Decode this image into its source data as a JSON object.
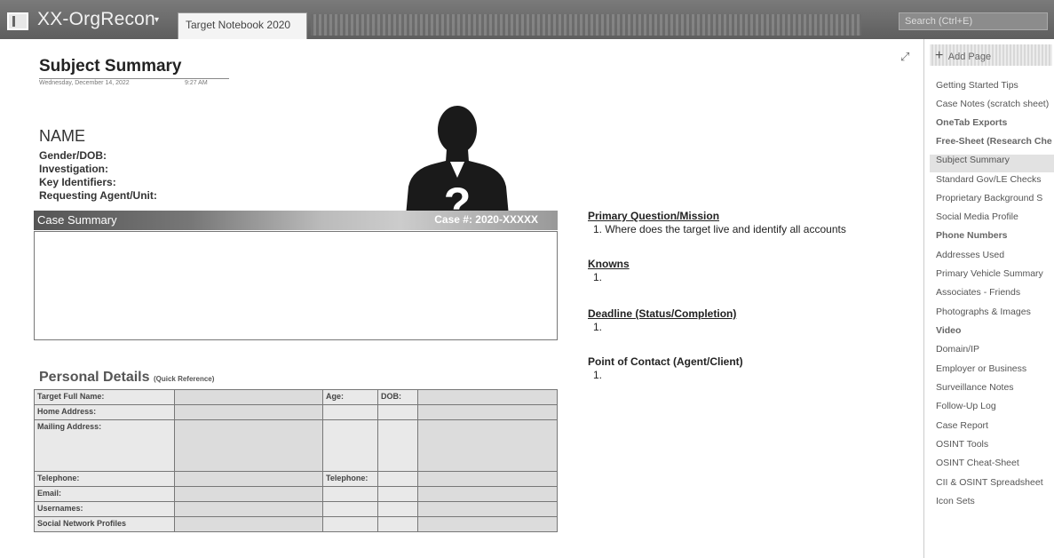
{
  "titlebar": {
    "notebook_name": "XX-OrgRecon",
    "dropdown_glyph": "▾",
    "active_tab": "Target Notebook 2020",
    "search_placeholder": "Search (Ctrl+E)"
  },
  "page": {
    "title": "Subject Summary",
    "date": "Wednesday, December 14, 2022",
    "time": "9:27 AM",
    "expand_glyph": "⤢",
    "name_heading": "NAME",
    "fields": [
      "Gender/DOB:",
      "Investigation:",
      "Key Identifiers:",
      "Requesting Agent/Unit:"
    ],
    "photo_placeholder_icon": "person-question-icon",
    "case_summary_label": "Case Summary",
    "case_number": "Case #: 2020-XXXXX"
  },
  "personal_details": {
    "heading": "Personal Details",
    "subheading": "(Quick Reference)",
    "rows": [
      [
        "Target Full Name:",
        "",
        "Age:",
        "DOB:",
        ""
      ],
      [
        "Home Address:",
        "",
        "",
        "",
        ""
      ],
      [
        "Mailing Address:",
        "",
        "",
        "",
        ""
      ],
      [
        "Telephone:",
        "",
        "Telephone:",
        "",
        ""
      ],
      [
        "Email:",
        "",
        "",
        "",
        ""
      ],
      [
        "Usernames:",
        "",
        "",
        "",
        ""
      ],
      [
        "Social Network Profiles",
        "",
        "",
        "",
        ""
      ]
    ]
  },
  "right_column": [
    {
      "heading": "Primary Question/Mission",
      "item": "1.   Where does the target live and identify all accounts"
    },
    {
      "heading": "Knowns",
      "item": "1."
    },
    {
      "heading": "Deadline (Status/Completion)",
      "item": "1."
    },
    {
      "heading": "Point of Contact (Agent/Client)",
      "item": "1."
    }
  ],
  "sidebar": {
    "add_page_label": "Add Page",
    "selected_index": 5,
    "pages": [
      {
        "label": "Getting Started Tips",
        "bold": false
      },
      {
        "label": "Case Notes (scratch sheet)",
        "bold": false
      },
      {
        "label": "OneTab Exports",
        "bold": true
      },
      {
        "label": "Free-Sheet (Research Che",
        "bold": true
      },
      {
        "label": "Subject Summary",
        "bold": false
      },
      {
        "label": "Standard Gov/LE Checks",
        "bold": false
      },
      {
        "label": "Proprietary Background S",
        "bold": false
      },
      {
        "label": "Social Media Profile",
        "bold": false
      },
      {
        "label": "Phone Numbers",
        "bold": true
      },
      {
        "label": "Addresses Used",
        "bold": false
      },
      {
        "label": "Primary Vehicle Summary",
        "bold": false
      },
      {
        "label": "Associates - Friends",
        "bold": false
      },
      {
        "label": "Photographs & Images",
        "bold": false
      },
      {
        "label": "Video",
        "bold": true
      },
      {
        "label": "Domain/IP",
        "bold": false
      },
      {
        "label": "Employer or Business",
        "bold": false
      },
      {
        "label": "Surveillance Notes",
        "bold": false
      },
      {
        "label": "Follow-Up Log",
        "bold": false
      },
      {
        "label": "Case Report",
        "bold": false
      },
      {
        "label": "OSINT Tools",
        "bold": false
      },
      {
        "label": "OSINT Cheat-Sheet",
        "bold": false
      },
      {
        "label": "CII & OSINT Spreadsheet",
        "bold": false
      },
      {
        "label": "Icon Sets",
        "bold": false
      }
    ]
  },
  "colors": {
    "titlebar": "#6b6b6b",
    "case_summary_bar": "#666666",
    "table_cell": "#e9e9e9"
  }
}
